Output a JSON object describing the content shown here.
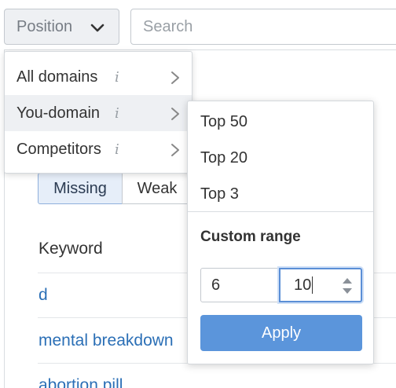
{
  "toolbar": {
    "position_label": "Position",
    "search_placeholder": "Search"
  },
  "filters": {
    "segments": [
      "Missing",
      "Weak"
    ],
    "active_segment": "Missing"
  },
  "table": {
    "column_keyword": "Keyword",
    "rows": [
      "d",
      "mental breakdown",
      "abortion pill"
    ]
  },
  "menu": {
    "items": [
      {
        "label": "All domains",
        "info": "i"
      },
      {
        "label": "You-domain",
        "info": "i"
      },
      {
        "label": "Competitors",
        "info": "i"
      }
    ],
    "active_item": "You-domain"
  },
  "submenu": {
    "options": [
      "Top 50",
      "Top 20",
      "Top 3"
    ],
    "custom_range_label": "Custom range",
    "range_from": "6",
    "range_to": "10",
    "apply_label": "Apply"
  },
  "colors": {
    "accent": "#5b95db",
    "link": "#2b6fb6",
    "active_bg": "#eef0f3"
  }
}
